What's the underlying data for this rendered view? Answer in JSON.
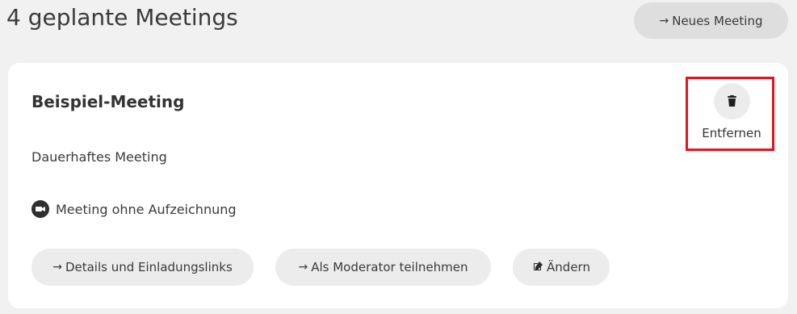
{
  "header": {
    "title": "4 geplante Meetings",
    "new_meeting_label": "Neues Meeting",
    "new_meeting_icon": "arrow-right-icon"
  },
  "meeting": {
    "title": "Beispiel-Meeting",
    "type": "Dauerhaftes Meeting",
    "recording_status": "Meeting ohne Aufzeichnung",
    "recording_icon": "video-camera-icon",
    "remove_label": "Entfernen",
    "remove_icon": "trash-icon",
    "actions": {
      "details_label": "Details und Einladungslinks",
      "moderator_label": "Als Moderator teilnehmen",
      "edit_label": "Ändern",
      "arrow_glyph": "→",
      "edit_icon": "edit-icon"
    }
  },
  "colors": {
    "page_background": "#f1f1f1",
    "card_background": "#ffffff",
    "button_background": "#ececec",
    "highlight_border": "#e3141f",
    "text": "#333333"
  }
}
